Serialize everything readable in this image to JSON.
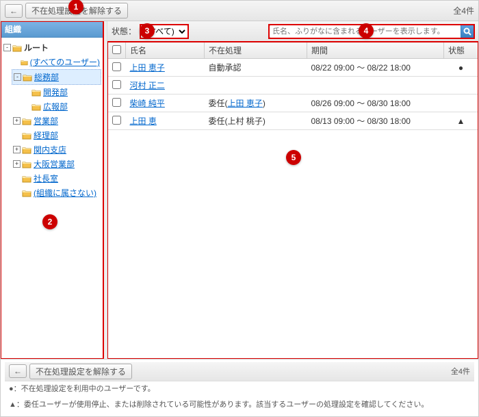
{
  "toolbar": {
    "back_label": "←",
    "clear_label": "不在処理設定を解除する",
    "count_label": "全4件"
  },
  "sidebar": {
    "header": "組織",
    "root_label": "ルート",
    "nodes": [
      {
        "label": "(すべてのユーザー)",
        "toggle": "",
        "selected": false
      },
      {
        "label": "総務部",
        "toggle": "-",
        "selected": true
      },
      {
        "label": "開発部",
        "toggle": "",
        "selected": false,
        "indent": true
      },
      {
        "label": "広報部",
        "toggle": "",
        "selected": false,
        "indent": true
      },
      {
        "label": "営業部",
        "toggle": "+",
        "selected": false
      },
      {
        "label": "経理部",
        "toggle": "",
        "selected": false
      },
      {
        "label": "関内支店",
        "toggle": "+",
        "selected": false
      },
      {
        "label": "大阪営業部",
        "toggle": "+",
        "selected": false
      },
      {
        "label": "社長室",
        "toggle": "",
        "selected": false
      },
      {
        "label": "(組織に属さない)",
        "toggle": "",
        "selected": false
      }
    ]
  },
  "filter": {
    "status_label": "状態：",
    "status_value": "(すべて)",
    "search_placeholder": "氏名、ふりがなに含まれるユーザーを表示します。"
  },
  "grid": {
    "headers": {
      "name": "氏名",
      "proxy": "不在処理",
      "period": "期間",
      "status": "状態"
    },
    "rows": [
      {
        "name": "上田 恵子",
        "proxy": "自動承認",
        "proxy_link": "",
        "period": "08/22 09:00 ～ 08/22 18:00",
        "status": "●"
      },
      {
        "name": "河村 正二",
        "proxy": "",
        "proxy_link": "",
        "period": "",
        "status": ""
      },
      {
        "name": "柴崎 純平",
        "proxy": "委任(",
        "proxy_link": "上田 恵子",
        "proxy_suffix": ")",
        "period": "08/26 09:00 ～ 08/30 18:00",
        "status": ""
      },
      {
        "name": "上田 恵",
        "proxy": "委任(上村 桃子)",
        "proxy_link": "",
        "period": "08/13 09:00 ～ 08/30 18:00",
        "status": "▲"
      }
    ]
  },
  "footer": {
    "back_label": "←",
    "clear_label": "不在処理設定を解除する",
    "count_label": "全4件",
    "legend1": "●：不在処理設定を利用中のユーザーです。",
    "legend2": "▲：委任ユーザーが使用停止、または削除されている可能性があります。該当するユーザーの処理設定を確認してください。"
  },
  "callouts": [
    "1",
    "2",
    "3",
    "4",
    "5"
  ]
}
